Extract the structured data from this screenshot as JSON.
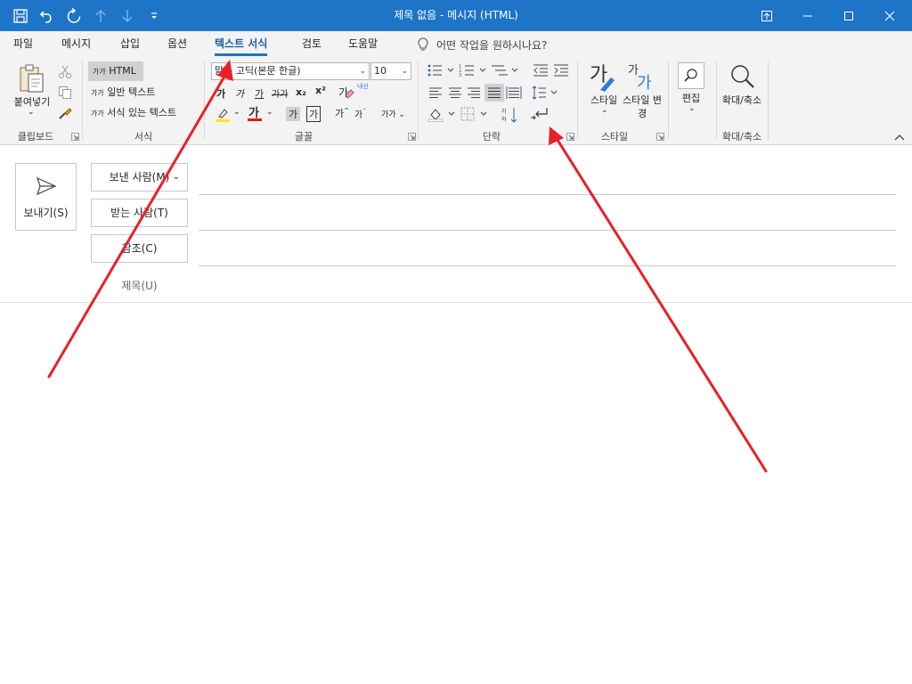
{
  "window": {
    "title": "제목 없음  -  메시지 (HTML)"
  },
  "tabs": [
    {
      "label": "파일"
    },
    {
      "label": "메시지"
    },
    {
      "label": "삽입"
    },
    {
      "label": "옵션"
    },
    {
      "label": "텍스트 서식",
      "active": true
    },
    {
      "label": "검토"
    },
    {
      "label": "도움말"
    }
  ],
  "tell_me": {
    "label": "어떤 작업을 원하시나요?"
  },
  "ribbon": {
    "clipboard": {
      "paste_label": "붙여넣기",
      "group_label": "클립보드"
    },
    "format": {
      "html_label": "HTML",
      "plain_label": "일반 텍스트",
      "rich_label": "서식 있는 텍스트",
      "prefix": "가가",
      "group_label": "서식"
    },
    "font": {
      "font_name": "맑은 고딕(본문 한글)",
      "font_size": "10",
      "group_label": "글꼴",
      "glyph_ga": "가",
      "glyph_phonetic": "내선",
      "glyph_sub": "x₂",
      "glyph_sup": "x²",
      "glyph_gaga": "가가"
    },
    "paragraph": {
      "group_label": "단락"
    },
    "styles": {
      "styles_label": "스타일",
      "change_label": "스타일 변경",
      "group_label": "스타일",
      "glyph": "가"
    },
    "editing": {
      "label": "편집"
    },
    "zoom": {
      "label": "확대/축소",
      "group_label": "확대/축소"
    }
  },
  "compose": {
    "send_label": "보내기(S)",
    "from_label": "보낸 사람(M)",
    "to_label": "받는 사람(T)",
    "cc_label": "참조(C)",
    "subject_label": "제목(U)"
  },
  "colors": {
    "title_bar": "#1e74c6",
    "ribbon_bg": "#f3f3f3",
    "annotation_arrow": "#e8202a",
    "highlight_yellow": "#ffe600",
    "font_red": "#e81123"
  }
}
